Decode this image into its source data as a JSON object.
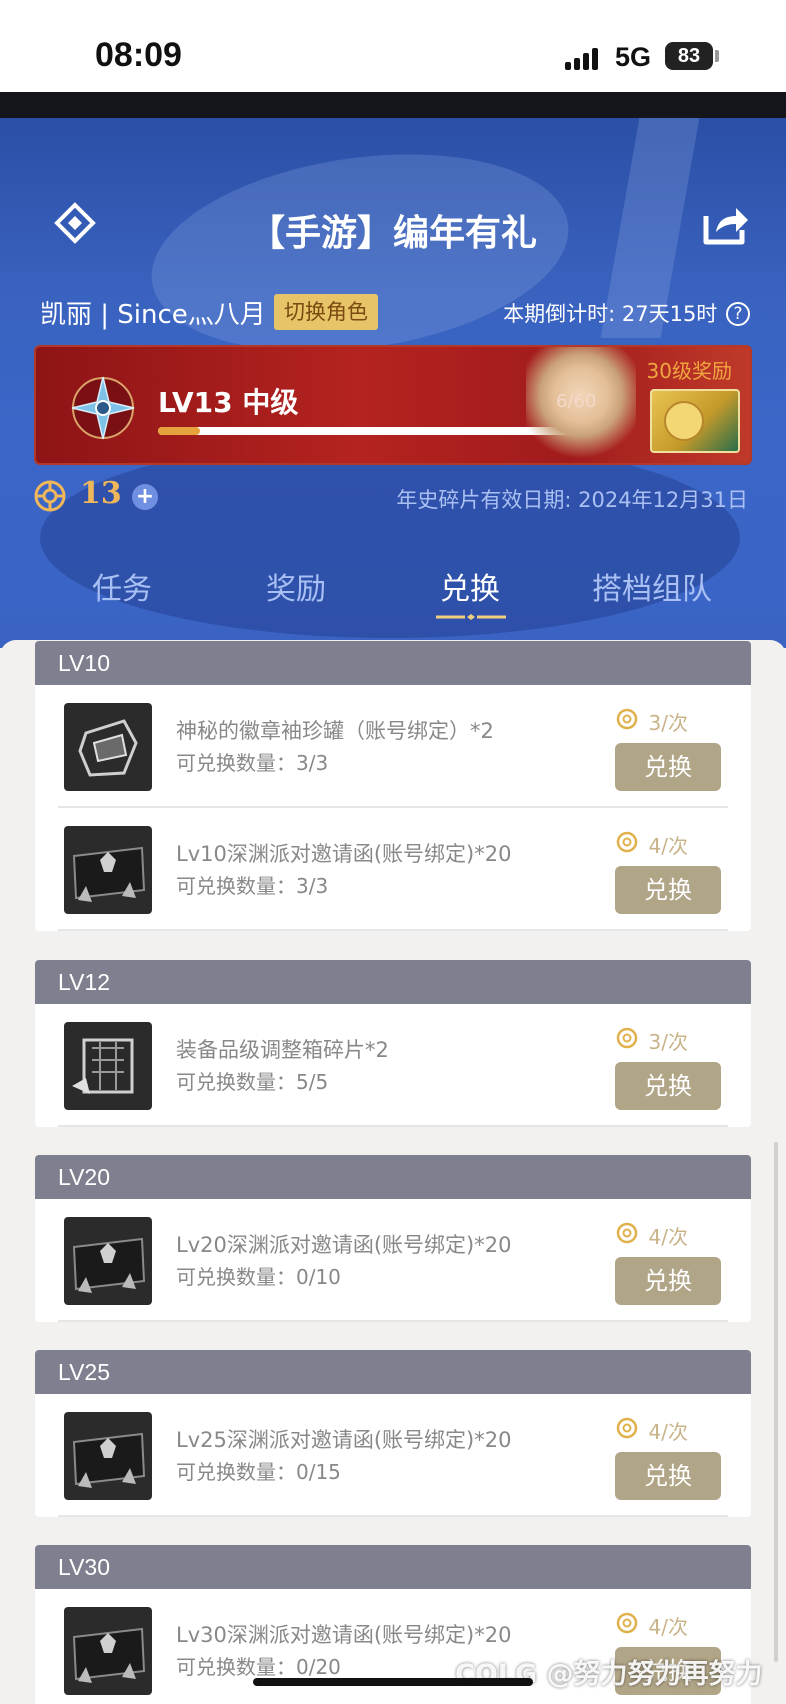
{
  "status_bar": {
    "time": "08:09",
    "network": "5G",
    "battery": "83"
  },
  "header": {
    "title": "【手游】编年有礼"
  },
  "user": {
    "name": "凯丽 | Since灬八月",
    "switch_label": "切换角色",
    "countdown": "本期倒计时: 27天15时"
  },
  "level": {
    "label": "LV13 中级",
    "progress_text": "6/60",
    "progress": 0.1,
    "reward_label": "30级奖励"
  },
  "currency": {
    "count": "13",
    "expiry": "年史碎片有效日期: 2024年12月31日"
  },
  "tabs": [
    {
      "label": "任务",
      "active": false
    },
    {
      "label": "奖励",
      "active": false
    },
    {
      "label": "兑换",
      "active": true
    },
    {
      "label": "搭档组队",
      "active": false
    }
  ],
  "groups": [
    {
      "level": "LV10",
      "items": [
        {
          "name": "神秘的徽章袖珍罐（账号绑定）*2",
          "qty": "可兑换数量：3/3",
          "cost": "3/次",
          "button": "兑换",
          "icon": "badge-jar-icon"
        },
        {
          "name": "Lv10深渊派对邀请函(账号绑定)*20",
          "qty": "可兑换数量：3/3",
          "cost": "4/次",
          "button": "兑换",
          "icon": "abyss-invitation-icon"
        }
      ]
    },
    {
      "level": "LV12",
      "items": [
        {
          "name": "装备品级调整箱碎片*2",
          "qty": "可兑换数量：5/5",
          "cost": "3/次",
          "button": "兑换",
          "icon": "equipment-box-fragment-icon"
        }
      ]
    },
    {
      "level": "LV20",
      "items": [
        {
          "name": "Lv20深渊派对邀请函(账号绑定)*20",
          "qty": "可兑换数量：0/10",
          "cost": "4/次",
          "button": "兑换",
          "icon": "abyss-invitation-icon"
        }
      ]
    },
    {
      "level": "LV25",
      "items": [
        {
          "name": "Lv25深渊派对邀请函(账号绑定)*20",
          "qty": "可兑换数量：0/15",
          "cost": "4/次",
          "button": "兑换",
          "icon": "abyss-invitation-icon"
        }
      ]
    },
    {
      "level": "LV30",
      "items": [
        {
          "name": "Lv30深渊派对邀请函(账号绑定)*20",
          "qty": "可兑换数量：0/20",
          "cost": "4/次",
          "button": "兑换",
          "icon": "abyss-invitation-icon"
        }
      ]
    }
  ],
  "watermark": "COLG @努力努力再努力",
  "colors": {
    "hero_blue": "#3a63c0",
    "group_header": "#7e8090",
    "button": "#b1a587",
    "gold": "#e7c468",
    "banner_red": "#b4231f"
  }
}
